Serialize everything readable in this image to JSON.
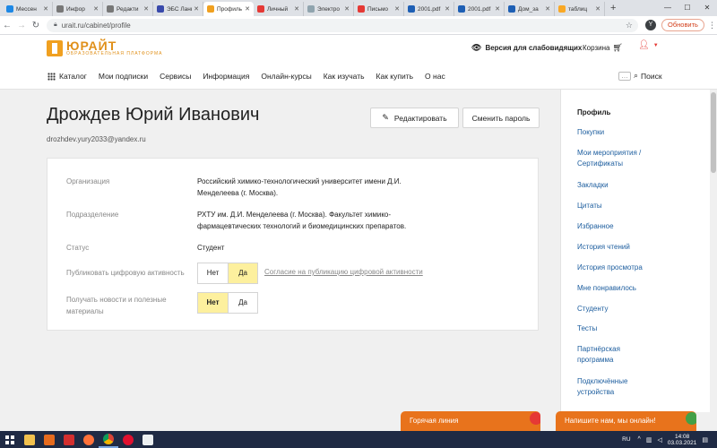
{
  "browser": {
    "tabs": [
      {
        "title": "Мессен",
        "color": "#1e88e5",
        "active": false
      },
      {
        "title": "Инфор",
        "color": "#555555",
        "active": false
      },
      {
        "title": "Редакти",
        "color": "#555555",
        "active": false
      },
      {
        "title": "ЭБС Лань",
        "color": "#3949ab",
        "active": false
      },
      {
        "title": "Профиль",
        "color": "#f0a020",
        "active": true
      },
      {
        "title": "Личный",
        "color": "#e53935",
        "active": false
      },
      {
        "title": "Электро",
        "color": "#90a4ae",
        "active": false
      },
      {
        "title": "Письмо",
        "color": "#e53935",
        "active": false
      },
      {
        "title": "2001.pdf",
        "color": "#1e5fb4",
        "active": false
      },
      {
        "title": "2001.pdf",
        "color": "#1e5fb4",
        "active": false
      },
      {
        "title": "Дом_за",
        "color": "#1e5fb4",
        "active": false
      },
      {
        "title": "таблиц",
        "color": "#f9a825",
        "active": false
      }
    ],
    "new_tab": "+",
    "url": "urait.ru/cabinet/profile",
    "profile_letter": "Y",
    "update_label": "Обновить"
  },
  "header": {
    "logo_text": "ЮРАЙТ",
    "logo_sub": "ОБРАЗОВАТЕЛЬНАЯ ПЛАТФОРМА",
    "a11y_label": "Версия для слабовидящих",
    "cart_label": "Корзина",
    "menu": [
      "Каталог",
      "Мои подписки",
      "Сервисы",
      "Информация",
      "Онлайн-курсы",
      "Как изучать",
      "Как купить",
      "О нас"
    ],
    "search_label": "Поиск"
  },
  "profile": {
    "name": "Дрождев Юрий Иванович",
    "email": "drozhdev.yury2033@yandex.ru",
    "edit_label": "Редактировать",
    "change_password_label": "Сменить пароль",
    "rows": {
      "org_label": "Организация",
      "org_value_1": "Российский химико-технологический университет имени Д.И.",
      "org_value_2": "Менделеева (г. Москва).",
      "dept_label": "Подразделение",
      "dept_value_1": "РХТУ им. Д.И. Менделеева (г. Москва). Факультет химико-",
      "dept_value_2": "фармацевтических технологий и биомедицинских препаратов.",
      "status_label": "Статус",
      "status_value": "Студент",
      "publish_label": "Публиковать цифровую активность",
      "publish_no": "Нет",
      "publish_yes": "Да",
      "publish_selected": "yes",
      "consent_link": "Согласие на публикацию цифровой активности",
      "news_label_1": "Получать новости и полезные",
      "news_label_2": "материалы",
      "news_no": "Нет",
      "news_yes": "Да",
      "news_selected": "no"
    }
  },
  "sidebar": {
    "items": [
      "Профиль",
      "Покупки",
      "Мои мероприятия /",
      "Сертификаты",
      "Закладки",
      "Цитаты",
      "Избранное",
      "История чтений",
      "История просмотра",
      "Мне понравилось",
      "Студенту",
      "Тесты",
      "Партнёрская",
      "программа",
      "Подключённые",
      "устройства"
    ]
  },
  "chat": {
    "hotline": "Горячая линия",
    "chat_now": "Напишите нам, мы онлайн!"
  },
  "taskbar": {
    "lang": "RU",
    "time": "14:08",
    "date": "03.03.2021"
  }
}
